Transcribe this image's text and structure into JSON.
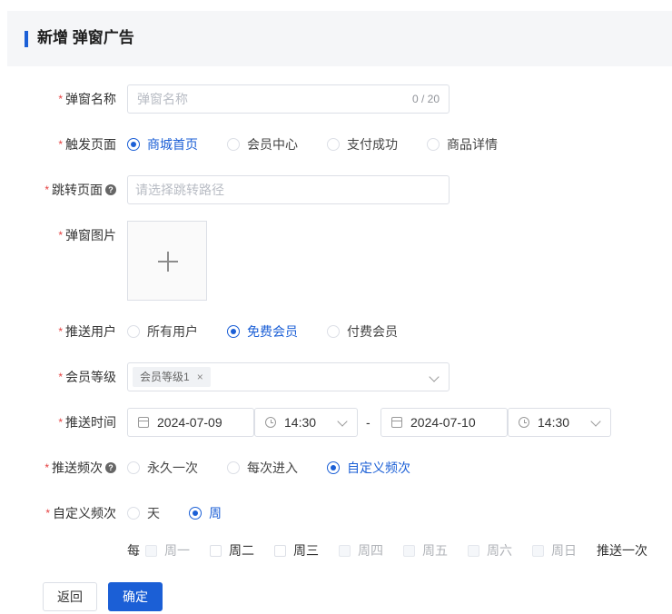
{
  "header": {
    "title": "新增 弹窗广告"
  },
  "form": {
    "name": {
      "label": "弹窗名称",
      "placeholder": "弹窗名称",
      "count": "0 / 20"
    },
    "trigger": {
      "label": "触发页面",
      "options": [
        "商城首页",
        "会员中心",
        "支付成功",
        "商品详情"
      ],
      "selected": 0
    },
    "jump": {
      "label": "跳转页面",
      "placeholder": "请选择跳转路径"
    },
    "image": {
      "label": "弹窗图片"
    },
    "users": {
      "label": "推送用户",
      "options": [
        "所有用户",
        "免费会员",
        "付费会员"
      ],
      "selected": 1
    },
    "level": {
      "label": "会员等级",
      "tag": "会员等级1",
      "tag_close": "×"
    },
    "time": {
      "label": "推送时间",
      "start_date": "2024-07-09",
      "start_time": "14:30",
      "separator": "-",
      "end_date": "2024-07-10",
      "end_time": "14:30"
    },
    "frequency": {
      "label": "推送频次",
      "options": [
        "永久一次",
        "每次进入",
        "自定义频次"
      ],
      "selected": 2
    },
    "custom": {
      "label": "自定义频次",
      "options": [
        "天",
        "周"
      ],
      "selected": 1
    },
    "week": {
      "prefix": "每",
      "days": [
        {
          "label": "周一",
          "disabled": true
        },
        {
          "label": "周二",
          "disabled": false
        },
        {
          "label": "周三",
          "disabled": false
        },
        {
          "label": "周四",
          "disabled": true
        },
        {
          "label": "周五",
          "disabled": true
        },
        {
          "label": "周六",
          "disabled": true
        },
        {
          "label": "周日",
          "disabled": true
        }
      ],
      "suffix": "推送一次"
    }
  },
  "buttons": {
    "back": "返回",
    "confirm": "确定"
  },
  "required_mark": "*",
  "help_mark": "?",
  "colors": {
    "primary": "#1b5fd6",
    "required": "#e53e3e",
    "header_bg": "#f5f6f8"
  }
}
